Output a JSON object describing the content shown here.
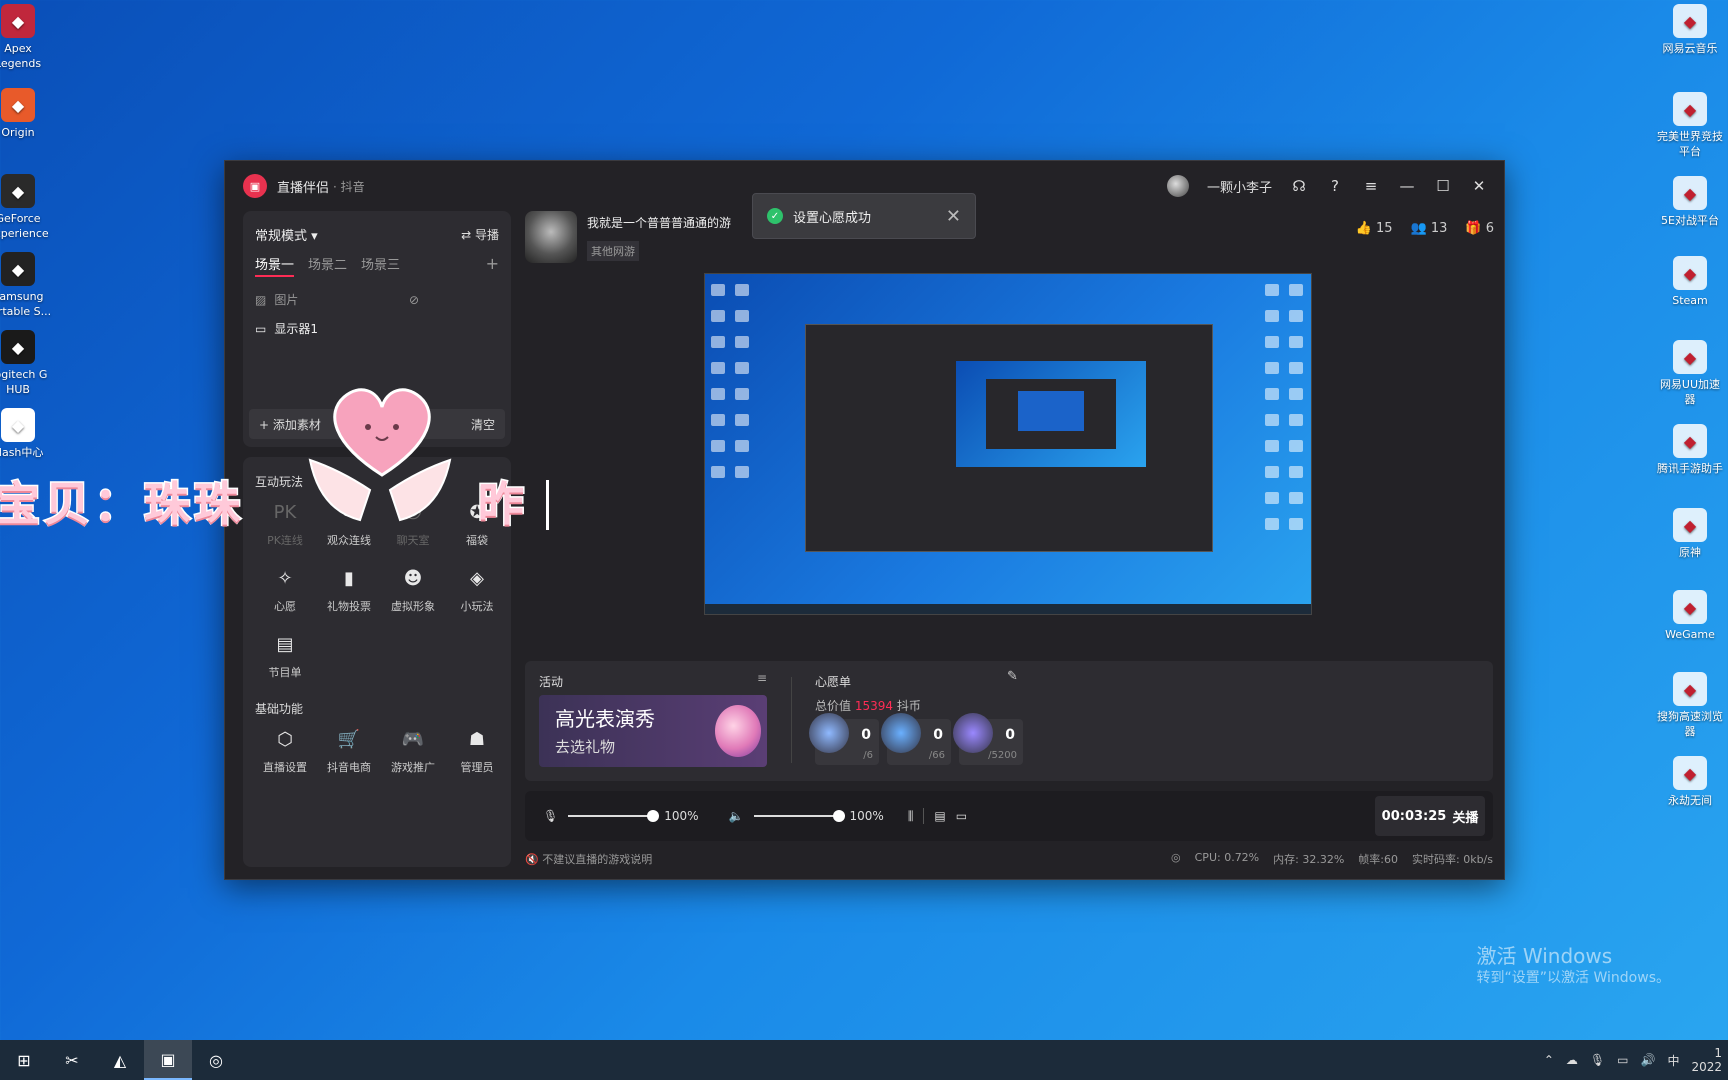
{
  "desktop_left": [
    {
      "label": "Apex\nLegends",
      "icon": "apex-icon"
    },
    {
      "label": "Origin",
      "icon": "origin-icon"
    },
    {
      "label": "GeForce\nExperience",
      "icon": "geforce-icon"
    },
    {
      "label": "Samsung\nPortable S...",
      "icon": "samsung-icon"
    },
    {
      "label": "Logitech G\nHUB",
      "icon": "logitech-icon"
    },
    {
      "label": "Flash中心",
      "icon": "flash-icon"
    }
  ],
  "desktop_right": [
    {
      "label": "网易云音乐",
      "icon": "netease-music-icon"
    },
    {
      "label": "完美世界竞技\n平台",
      "icon": "perfect-world-icon"
    },
    {
      "label": "5E对战平台",
      "icon": "5e-icon"
    },
    {
      "label": "Steam",
      "icon": "steam-icon"
    },
    {
      "label": "网易UU加速\n器",
      "icon": "uu-icon"
    },
    {
      "label": "腾讯手游助手",
      "icon": "tencent-icon"
    },
    {
      "label": "原神",
      "icon": "genshin-icon"
    },
    {
      "label": "WeGame",
      "icon": "wegame-icon"
    },
    {
      "label": "搜狗高速浏览\n器",
      "icon": "sogou-icon"
    },
    {
      "label": "永劫无间",
      "icon": "naraka-icon"
    }
  ],
  "watermark": {
    "line1": "激活 Windows",
    "line2": "转到“设置”以激活 Windows。"
  },
  "app": {
    "name": "直播伴侣",
    "sub": "· 抖音",
    "user": "一颗小李子",
    "toast": "设置心愿成功",
    "mode": "常规模式",
    "guide": "导播",
    "scenes": [
      "场景一",
      "场景二",
      "场景三"
    ],
    "sources": {
      "image": "图片",
      "display": "显示器1"
    },
    "add_label": "添加素材",
    "clear_label": "清空",
    "section_interact": "互动玩法",
    "section_basic": "基础功能",
    "interact_tools": [
      {
        "label": "PK连线",
        "icon": "pk-icon",
        "dim": true
      },
      {
        "label": "观众连线",
        "icon": "link-icon",
        "dim": false
      },
      {
        "label": "聊天室",
        "icon": "chat-room-icon",
        "dim": true
      },
      {
        "label": "福袋",
        "icon": "lucky-bag-icon",
        "dim": false
      },
      {
        "label": "心愿",
        "icon": "wish-icon",
        "dim": false
      },
      {
        "label": "礼物投票",
        "icon": "gift-vote-icon",
        "dim": false
      },
      {
        "label": "虚拟形象",
        "icon": "avatar-icon",
        "dim": false
      },
      {
        "label": "小玩法",
        "icon": "mini-game-icon",
        "dim": false
      },
      {
        "label": "节目单",
        "icon": "program-icon",
        "dim": false
      }
    ],
    "basic_tools": [
      {
        "label": "直播设置",
        "icon": "live-settings-icon"
      },
      {
        "label": "抖音电商",
        "icon": "ecommerce-icon"
      },
      {
        "label": "游戏推广",
        "icon": "gamepad-icon"
      },
      {
        "label": "管理员",
        "icon": "admin-icon"
      }
    ],
    "stream_title": "我就是一个普普普通通的游",
    "stream_tag": "其他网游",
    "stats": {
      "likes": "15",
      "viewers": "13",
      "gifts": "6"
    },
    "activity_label": "活动",
    "banner_title": "高光表演秀",
    "banner_sub": "去选礼物",
    "wish_label": "心愿单",
    "wish_total_prefix": "总价值",
    "wish_total_value": "15394",
    "wish_total_unit": "抖币",
    "wishes": [
      {
        "count": "0",
        "target": "/6",
        "color": "#8fb9ff"
      },
      {
        "count": "0",
        "target": "/66",
        "color": "#6ab0ff"
      },
      {
        "count": "0",
        "target": "/5200",
        "color": "#9a88ff"
      }
    ],
    "mic_volume": "100%",
    "speaker_volume": "100%",
    "timer": "00:03:25",
    "stop_label": "关播",
    "footer_left": "不建议直播的游戏说明",
    "cpu": "CPU: 0.72%",
    "mem": "内存: 32.32%",
    "fps": "帧率:60",
    "bitrate": "实时码率: 0kb/s"
  },
  "caption": {
    "text": "宝贝：珠珠",
    "tail": "昨"
  },
  "tray": {
    "ime": "中",
    "time": "1",
    "date": "2022"
  }
}
